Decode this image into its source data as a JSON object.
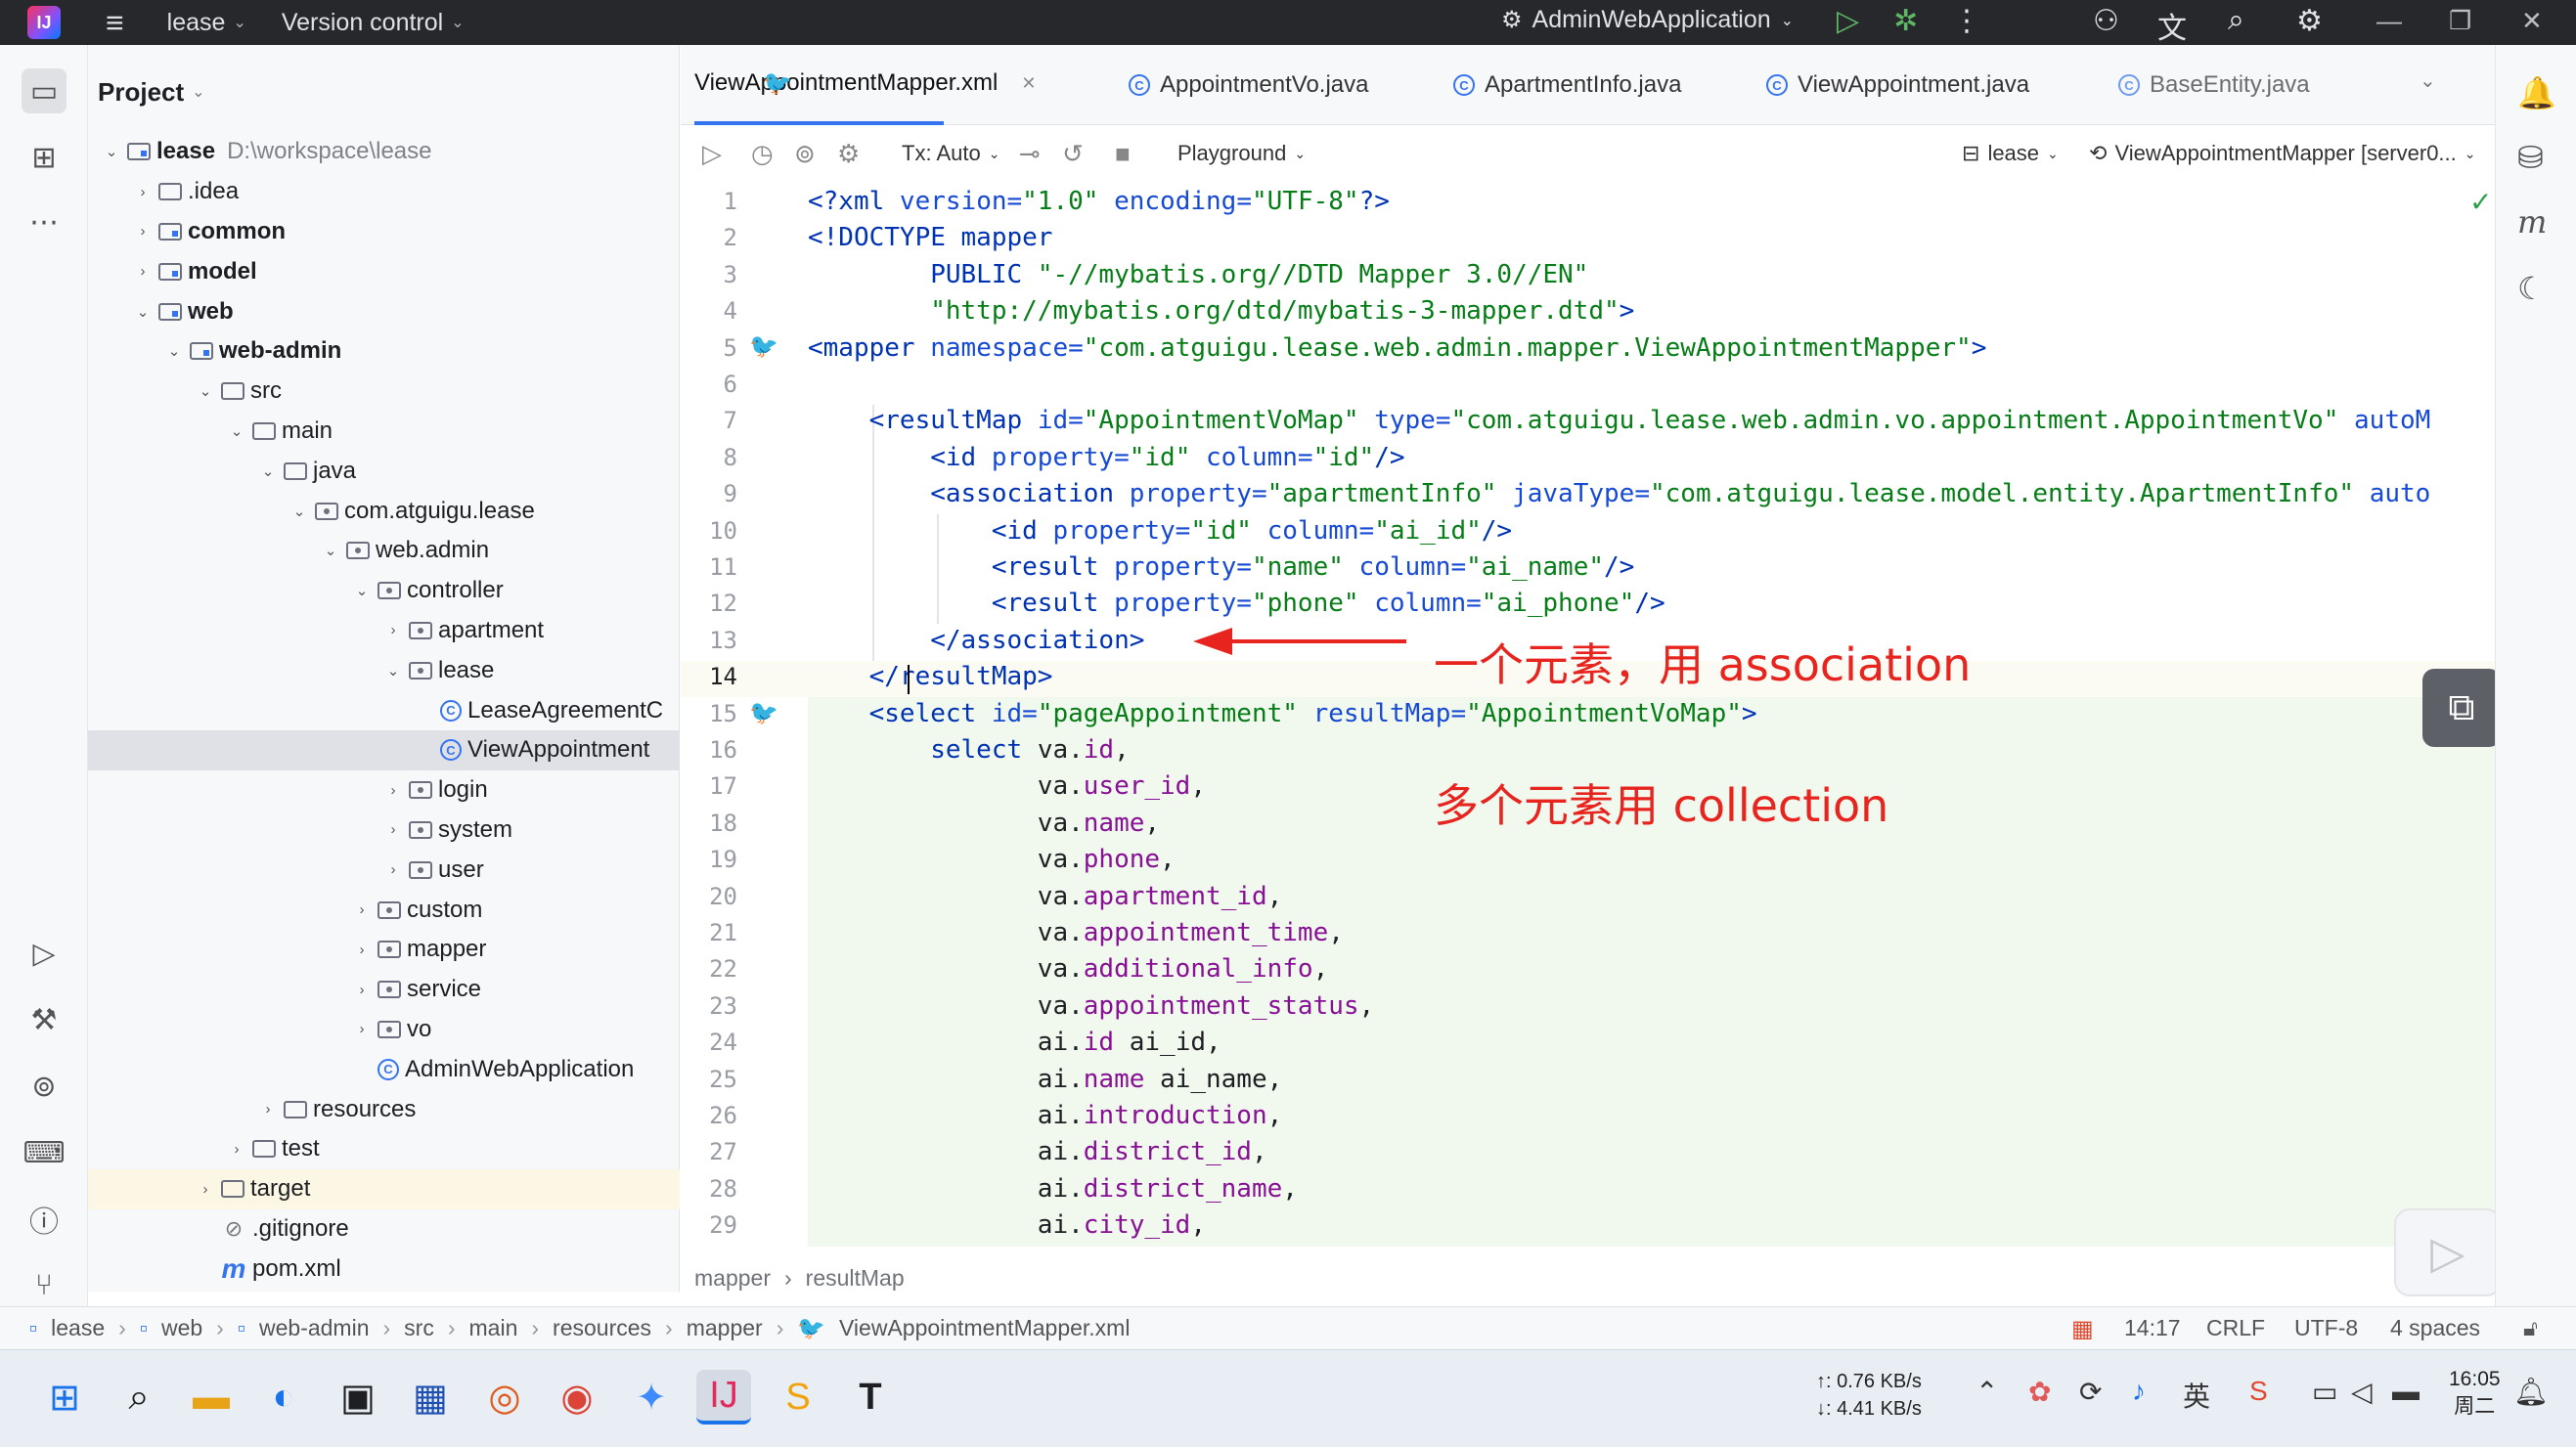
{
  "titlebar": {
    "project": "lease",
    "vcs": "Version control",
    "run_config": "AdminWebApplication"
  },
  "project_panel": {
    "title": "Project",
    "root_name": "lease",
    "root_path": "D:\\workspace\\lease",
    "items": [
      {
        "label": ".idea",
        "depth": 1,
        "arrow": "›",
        "icon": "folder",
        "bold": false
      },
      {
        "label": "common",
        "depth": 1,
        "arrow": "›",
        "icon": "module",
        "bold": true
      },
      {
        "label": "model",
        "depth": 1,
        "arrow": "›",
        "icon": "module",
        "bold": true
      },
      {
        "label": "web",
        "depth": 1,
        "arrow": "⌄",
        "icon": "module",
        "bold": true
      },
      {
        "label": "web-admin",
        "depth": 2,
        "arrow": "⌄",
        "icon": "module",
        "bold": true
      },
      {
        "label": "src",
        "depth": 3,
        "arrow": "⌄",
        "icon": "folder",
        "bold": false
      },
      {
        "label": "main",
        "depth": 4,
        "arrow": "⌄",
        "icon": "folder",
        "bold": false
      },
      {
        "label": "java",
        "depth": 5,
        "arrow": "⌄",
        "icon": "folder",
        "bold": false
      },
      {
        "label": "com.atguigu.lease",
        "depth": 6,
        "arrow": "⌄",
        "icon": "pkg",
        "bold": false
      },
      {
        "label": "web.admin",
        "depth": 7,
        "arrow": "⌄",
        "icon": "pkg",
        "bold": false
      },
      {
        "label": "controller",
        "depth": 8,
        "arrow": "⌄",
        "icon": "pkg",
        "bold": false
      },
      {
        "label": "apartment",
        "depth": 9,
        "arrow": "›",
        "icon": "pkg",
        "bold": false
      },
      {
        "label": "lease",
        "depth": 9,
        "arrow": "⌄",
        "icon": "pkg",
        "bold": false
      },
      {
        "label": "LeaseAgreementC",
        "depth": 10,
        "arrow": "",
        "icon": "cls",
        "bold": false
      },
      {
        "label": "ViewAppointment",
        "depth": 10,
        "arrow": "",
        "icon": "cls",
        "bold": false,
        "selected": true
      },
      {
        "label": "login",
        "depth": 9,
        "arrow": "›",
        "icon": "pkg",
        "bold": false
      },
      {
        "label": "system",
        "depth": 9,
        "arrow": "›",
        "icon": "pkg",
        "bold": false
      },
      {
        "label": "user",
        "depth": 9,
        "arrow": "›",
        "icon": "pkg",
        "bold": false
      },
      {
        "label": "custom",
        "depth": 8,
        "arrow": "›",
        "icon": "pkg",
        "bold": false
      },
      {
        "label": "mapper",
        "depth": 8,
        "arrow": "›",
        "icon": "pkg",
        "bold": false
      },
      {
        "label": "service",
        "depth": 8,
        "arrow": "›",
        "icon": "pkg",
        "bold": false
      },
      {
        "label": "vo",
        "depth": 8,
        "arrow": "›",
        "icon": "pkg",
        "bold": false
      },
      {
        "label": "AdminWebApplication",
        "depth": 8,
        "arrow": "",
        "icon": "app",
        "bold": false
      },
      {
        "label": "resources",
        "depth": 5,
        "arrow": "›",
        "icon": "folder",
        "bold": false
      },
      {
        "label": "test",
        "depth": 4,
        "arrow": "›",
        "icon": "folder",
        "bold": false
      },
      {
        "label": "target",
        "depth": 3,
        "arrow": "›",
        "icon": "folder",
        "bold": false,
        "highlight": true
      },
      {
        "label": ".gitignore",
        "depth": 3,
        "arrow": "",
        "icon": "ign",
        "bold": false
      },
      {
        "label": "pom.xml",
        "depth": 3,
        "arrow": "",
        "icon": "mvn",
        "bold": false
      }
    ]
  },
  "tabs": [
    {
      "label": "ViewAppointmentMapper.xml",
      "icon": "mybatis",
      "active": true,
      "closable": true
    },
    {
      "label": "AppointmentVo.java",
      "icon": "class"
    },
    {
      "label": "ApartmentInfo.java",
      "icon": "class"
    },
    {
      "label": "ViewAppointment.java",
      "icon": "class"
    },
    {
      "label": "BaseEntity.java",
      "icon": "class"
    }
  ],
  "editor_toolbar": {
    "tx": "Tx: Auto",
    "playground": "Playground",
    "datasource": "lease",
    "target": "ViewAppointmentMapper [server0..."
  },
  "code_lines": [
    [
      {
        "t": "<?xml ",
        "c": "tg"
      },
      {
        "t": "version=",
        "c": "at"
      },
      {
        "t": "\"1.0\"",
        "c": "av"
      },
      {
        "t": " encoding=",
        "c": "at"
      },
      {
        "t": "\"UTF-8\"",
        "c": "av"
      },
      {
        "t": "?>",
        "c": "tg"
      }
    ],
    [
      {
        "t": "<!DOCTYPE mapper",
        "c": "tg"
      }
    ],
    [
      {
        "t": "        PUBLIC ",
        "c": "tg"
      },
      {
        "t": "\"-//mybatis.org//DTD Mapper 3.0//EN\"",
        "c": "av"
      }
    ],
    [
      {
        "t": "        \"http://mybatis.org/dtd/mybatis-3-mapper.dtd\"",
        "c": "av"
      },
      {
        "t": ">",
        "c": "tg"
      }
    ],
    [
      {
        "t": "<mapper ",
        "c": "tg"
      },
      {
        "t": "namespace=",
        "c": "at"
      },
      {
        "t": "\"com.atguigu.lease.web.admin.mapper.ViewAppointmentMapper\"",
        "c": "av"
      },
      {
        "t": ">",
        "c": "tg"
      }
    ],
    [],
    [
      {
        "t": "    <resultMap ",
        "c": "tg"
      },
      {
        "t": "id=",
        "c": "at"
      },
      {
        "t": "\"AppointmentVoMap\"",
        "c": "av"
      },
      {
        "t": " type=",
        "c": "at"
      },
      {
        "t": "\"com.atguigu.lease.web.admin.vo.appointment.AppointmentVo\"",
        "c": "av"
      },
      {
        "t": " autoM",
        "c": "at"
      }
    ],
    [
      {
        "t": "        <id ",
        "c": "tg"
      },
      {
        "t": "property=",
        "c": "at"
      },
      {
        "t": "\"id\"",
        "c": "av"
      },
      {
        "t": " column=",
        "c": "at"
      },
      {
        "t": "\"id\"",
        "c": "av"
      },
      {
        "t": "/>",
        "c": "tg"
      }
    ],
    [
      {
        "t": "        <association ",
        "c": "tg"
      },
      {
        "t": "property=",
        "c": "at"
      },
      {
        "t": "\"apartmentInfo\"",
        "c": "av"
      },
      {
        "t": " javaType=",
        "c": "at"
      },
      {
        "t": "\"com.atguigu.lease.model.entity.ApartmentInfo\"",
        "c": "av"
      },
      {
        "t": " auto",
        "c": "at"
      }
    ],
    [
      {
        "t": "            <id ",
        "c": "tg"
      },
      {
        "t": "property=",
        "c": "at"
      },
      {
        "t": "\"id\"",
        "c": "av"
      },
      {
        "t": " column=",
        "c": "at"
      },
      {
        "t": "\"ai_id\"",
        "c": "av"
      },
      {
        "t": "/>",
        "c": "tg"
      }
    ],
    [
      {
        "t": "            <result ",
        "c": "tg"
      },
      {
        "t": "property=",
        "c": "at"
      },
      {
        "t": "\"name\"",
        "c": "av"
      },
      {
        "t": " column=",
        "c": "at"
      },
      {
        "t": "\"ai_name\"",
        "c": "av"
      },
      {
        "t": "/>",
        "c": "tg"
      }
    ],
    [
      {
        "t": "            <result ",
        "c": "tg"
      },
      {
        "t": "property=",
        "c": "at"
      },
      {
        "t": "\"phone\"",
        "c": "av"
      },
      {
        "t": " column=",
        "c": "at"
      },
      {
        "t": "\"ai_phone\"",
        "c": "av"
      },
      {
        "t": "/>",
        "c": "tg"
      }
    ],
    [
      {
        "t": "        </association>",
        "c": "tg"
      }
    ],
    [
      {
        "t": "    </resultMap>",
        "c": "tg"
      }
    ],
    [
      {
        "t": "    <select ",
        "c": "tg"
      },
      {
        "t": "id=",
        "c": "at"
      },
      {
        "t": "\"pageAppointment\"",
        "c": "av"
      },
      {
        "t": " resultMap=",
        "c": "at"
      },
      {
        "t": "\"AppointmentVoMap\"",
        "c": "av"
      },
      {
        "t": ">",
        "c": "tg"
      }
    ],
    [
      {
        "t": "        select ",
        "c": "tg"
      },
      {
        "t": "va.",
        "c": "pl"
      },
      {
        "t": "id",
        "c": "fld"
      },
      {
        "t": ",",
        "c": "pl"
      }
    ],
    [
      {
        "t": "               va.",
        "c": "pl"
      },
      {
        "t": "user_id",
        "c": "fld"
      },
      {
        "t": ",",
        "c": "pl"
      }
    ],
    [
      {
        "t": "               va.",
        "c": "pl"
      },
      {
        "t": "name",
        "c": "fld"
      },
      {
        "t": ",",
        "c": "pl"
      }
    ],
    [
      {
        "t": "               va.",
        "c": "pl"
      },
      {
        "t": "phone",
        "c": "fld"
      },
      {
        "t": ",",
        "c": "pl"
      }
    ],
    [
      {
        "t": "               va.",
        "c": "pl"
      },
      {
        "t": "apartment_id",
        "c": "fld"
      },
      {
        "t": ",",
        "c": "pl"
      }
    ],
    [
      {
        "t": "               va.",
        "c": "pl"
      },
      {
        "t": "appointment_time",
        "c": "fld"
      },
      {
        "t": ",",
        "c": "pl"
      }
    ],
    [
      {
        "t": "               va.",
        "c": "pl"
      },
      {
        "t": "additional_info",
        "c": "fld"
      },
      {
        "t": ",",
        "c": "pl"
      }
    ],
    [
      {
        "t": "               va.",
        "c": "pl"
      },
      {
        "t": "appointment_status",
        "c": "fld"
      },
      {
        "t": ",",
        "c": "pl"
      }
    ],
    [
      {
        "t": "               ai.",
        "c": "pl"
      },
      {
        "t": "id",
        "c": "fld"
      },
      {
        "t": " ai_id,",
        "c": "pl"
      }
    ],
    [
      {
        "t": "               ai.",
        "c": "pl"
      },
      {
        "t": "name",
        "c": "fld"
      },
      {
        "t": " ai_name,",
        "c": "pl"
      }
    ],
    [
      {
        "t": "               ai.",
        "c": "pl"
      },
      {
        "t": "introduction",
        "c": "fld"
      },
      {
        "t": ",",
        "c": "pl"
      }
    ],
    [
      {
        "t": "               ai.",
        "c": "pl"
      },
      {
        "t": "district_id",
        "c": "fld"
      },
      {
        "t": ",",
        "c": "pl"
      }
    ],
    [
      {
        "t": "               ai.",
        "c": "pl"
      },
      {
        "t": "district_name",
        "c": "fld"
      },
      {
        "t": ",",
        "c": "pl"
      }
    ],
    [
      {
        "t": "               ai.",
        "c": "pl"
      },
      {
        "t": "city_id",
        "c": "fld"
      },
      {
        "t": ",",
        "c": "pl"
      }
    ]
  ],
  "current_line": 14,
  "annotations": {
    "one_element": "一个元素，用 association",
    "many_elements": "多个元素用 collection"
  },
  "editor_breadcrumb": [
    "mapper",
    "resultMap"
  ],
  "status": {
    "crumbs": [
      "lease",
      "web",
      "web-admin",
      "src",
      "main",
      "resources",
      "mapper",
      "ViewAppointmentMapper.xml"
    ],
    "position": "14:17",
    "line_sep": "CRLF",
    "encoding": "UTF-8",
    "indent": "4 spaces"
  },
  "taskbar": {
    "net_up": "↑: 0.76 KB/s",
    "net_down": "↓: 4.41 KB/s",
    "time": "16:05",
    "day": "周二"
  }
}
